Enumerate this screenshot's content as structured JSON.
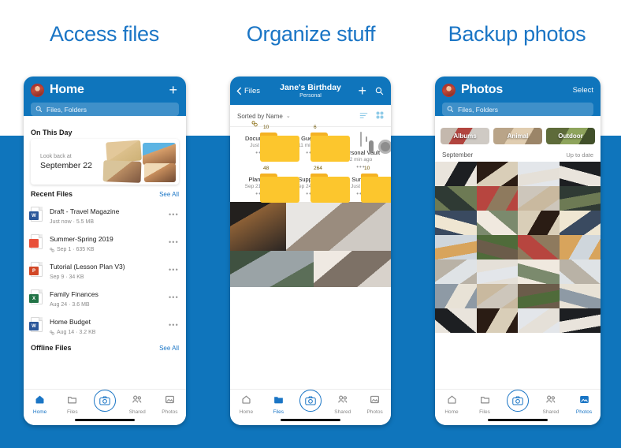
{
  "headings": [
    {
      "text": "Access files"
    },
    {
      "text": "Organize stuff"
    },
    {
      "text": "Backup photos"
    }
  ],
  "colors": {
    "brand_blue": "#0f75bc",
    "background_blue": "#0f75bc",
    "heading_blue": "#1a75c5",
    "folder_yellow": "#fcc62d",
    "link_blue": "#1a75c5"
  },
  "phone1": {
    "header": {
      "title": "Home",
      "avatar": "user-avatar",
      "add_icon": "plus-icon",
      "search_placeholder": "Files, Folders",
      "search_icon": "search-icon"
    },
    "on_this_day": {
      "section_title": "On This Day",
      "look_back_label": "Look back at",
      "date": "September 22"
    },
    "recent": {
      "section_title": "Recent Files",
      "see_all": "See All",
      "files": [
        {
          "name": "Draft - Travel Magazine",
          "meta": "Just now · 5.5 MB",
          "type": "word",
          "shared": false
        },
        {
          "name": "Summer-Spring 2019",
          "meta": "Sep 1 · 635 KB",
          "type": "pdf",
          "shared": true
        },
        {
          "name": "Tutorial (Lesson Plan V3)",
          "meta": "Sep 9 · 34 KB",
          "type": "ppt",
          "shared": false
        },
        {
          "name": "Family Finances",
          "meta": "Aug 24 · 3.6 MB",
          "type": "xls",
          "shared": false
        },
        {
          "name": "Home Budget",
          "meta": "Aug 14 · 3.2 KB",
          "type": "word",
          "shared": true
        }
      ]
    },
    "offline": {
      "section_title": "Offline Files",
      "see_all": "See All"
    },
    "tabs": [
      {
        "label": "Home",
        "icon": "home-icon",
        "active": true
      },
      {
        "label": "Files",
        "icon": "folder-icon",
        "active": false
      },
      {
        "label": "",
        "icon": "camera-icon",
        "active": false
      },
      {
        "label": "Shared",
        "icon": "shared-people-icon",
        "active": false
      },
      {
        "label": "Photos",
        "icon": "photos-icon",
        "active": false
      }
    ]
  },
  "phone2": {
    "header": {
      "back_label": "Files",
      "back_icon": "chevron-left-icon",
      "title": "Jane's Birthday",
      "subtitle": "Personal",
      "add_icon": "plus-icon",
      "search_icon": "search-icon"
    },
    "sortbar": {
      "sort_label": "Sorted by Name",
      "chevron": "chevron-down-icon",
      "list_view_icon": "list-view-icon",
      "grid_view_icon": "grid-view-icon"
    },
    "folders": [
      {
        "name": "Documents",
        "count": "10",
        "meta": "Just now",
        "shared": true,
        "kind": "folder"
      },
      {
        "name": "Guests",
        "count": "6",
        "meta": "11 min ago",
        "shared": false,
        "kind": "folder"
      },
      {
        "name": "Personal Vault",
        "count": "",
        "meta": "2 min ago",
        "shared": false,
        "kind": "vault"
      },
      {
        "name": "Planning",
        "count": "48",
        "meta": "Sep 21, 2020",
        "shared": false,
        "kind": "folder"
      },
      {
        "name": "Suppliers",
        "count": "264",
        "meta": "Sep 24, 2020",
        "shared": false,
        "kind": "folder"
      },
      {
        "name": "Survey",
        "count": "10",
        "meta": "Just now",
        "shared": false,
        "kind": "folder"
      }
    ],
    "overflow_label": "•••",
    "tabs": [
      {
        "label": "Home",
        "icon": "home-icon",
        "active": false
      },
      {
        "label": "Files",
        "icon": "folder-icon",
        "active": true
      },
      {
        "label": "",
        "icon": "camera-icon",
        "active": false
      },
      {
        "label": "Shared",
        "icon": "shared-people-icon",
        "active": false
      },
      {
        "label": "Photos",
        "icon": "photos-icon",
        "active": false
      }
    ]
  },
  "phone3": {
    "header": {
      "title": "Photos",
      "avatar": "user-avatar",
      "select_label": "Select",
      "search_placeholder": "Files, Folders",
      "search_icon": "search-icon"
    },
    "chips": [
      {
        "label": "Albums"
      },
      {
        "label": "Animal"
      },
      {
        "label": "Outdoor"
      }
    ],
    "section": {
      "month": "September",
      "status": "Up to date"
    },
    "tabs": [
      {
        "label": "Home",
        "icon": "home-icon",
        "active": false
      },
      {
        "label": "Files",
        "icon": "folder-icon",
        "active": false
      },
      {
        "label": "",
        "icon": "camera-icon",
        "active": false
      },
      {
        "label": "Shared",
        "icon": "shared-people-icon",
        "active": false
      },
      {
        "label": "Photos",
        "icon": "photos-icon",
        "active": true
      }
    ]
  }
}
